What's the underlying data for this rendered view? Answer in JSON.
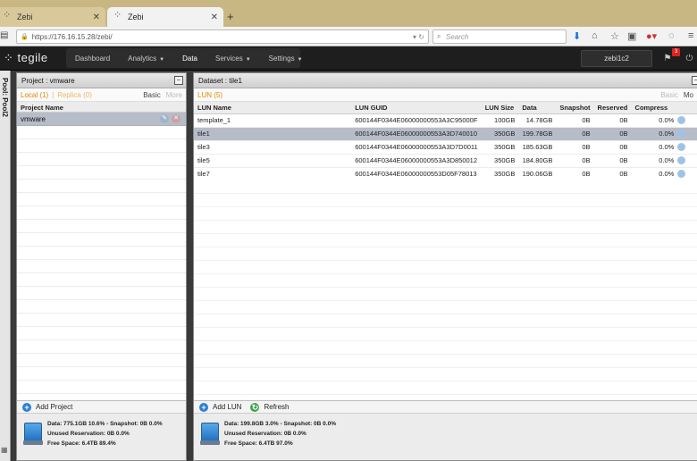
{
  "browser": {
    "tabs": [
      {
        "label": "Zebi",
        "active": false
      },
      {
        "label": "Zebi",
        "active": true
      }
    ],
    "url": "https://176.16.15.28/zebi/",
    "search_placeholder": "Search"
  },
  "app": {
    "logo": "tegile",
    "menu": [
      {
        "label": "Dashboard",
        "has_caret": false
      },
      {
        "label": "Analytics",
        "has_caret": true
      },
      {
        "label": "Data",
        "has_caret": false,
        "active": true
      },
      {
        "label": "Services",
        "has_caret": true
      },
      {
        "label": "Settings",
        "has_caret": true
      }
    ],
    "user": "zebi1c2",
    "notification_count": "3"
  },
  "pool_strip": {
    "label": "Pool: Pool2"
  },
  "project_panel": {
    "title": "Project : vmware",
    "tab_local": "Local (1)",
    "tab_replica": "Replica (0)",
    "basic": "Basic",
    "more": "More",
    "column": "Project Name",
    "rows": [
      "vmware"
    ],
    "add_label": "Add Project",
    "stats": {
      "line1": "Data: 775.1GB 10.6% - Snapshot: 0B 0.0%",
      "line2": "Unused Reservation: 0B 0.0%",
      "line3": "Free Space: 6.4TB 89.4%"
    }
  },
  "dataset_panel": {
    "title": "Dataset : tile1",
    "tab_lun": "LUN (5)",
    "basic": "Basic",
    "more": "Mo",
    "columns": [
      "LUN Name",
      "LUN GUID",
      "LUN Size",
      "Data",
      "Snapshot",
      "Reserved",
      "Compress"
    ],
    "rows": [
      {
        "name": "template_1",
        "guid": "600144F0344E06000000553A3C95000F",
        "size": "100GB",
        "data": "14.78GB",
        "snapshot": "0B",
        "reserved": "0B",
        "compress": "0.0%",
        "selected": false
      },
      {
        "name": "tile1",
        "guid": "600144F0344E06000000553A3D740010",
        "size": "350GB",
        "data": "199.78GB",
        "snapshot": "0B",
        "reserved": "0B",
        "compress": "0.0%",
        "selected": true
      },
      {
        "name": "tile3",
        "guid": "600144F0344E06000000553A3D7D0011",
        "size": "350GB",
        "data": "185.63GB",
        "snapshot": "0B",
        "reserved": "0B",
        "compress": "0.0%",
        "selected": false
      },
      {
        "name": "tile5",
        "guid": "600144F0344E06000000553A3D850012",
        "size": "350GB",
        "data": "184.80GB",
        "snapshot": "0B",
        "reserved": "0B",
        "compress": "0.0%",
        "selected": false
      },
      {
        "name": "tile7",
        "guid": "600144F0344E06000000553D05F78013",
        "size": "350GB",
        "data": "190.06GB",
        "snapshot": "0B",
        "reserved": "0B",
        "compress": "0.0%",
        "selected": false
      }
    ],
    "add_label": "Add LUN",
    "refresh_label": "Refresh",
    "stats": {
      "line1": "Data: 199.8GB 3.0% - Snapshot: 0B 0.0%",
      "line2": "Unused Reservation: 0B 0.0%",
      "line3": "Free Space: 6.4TB 97.0%"
    }
  }
}
